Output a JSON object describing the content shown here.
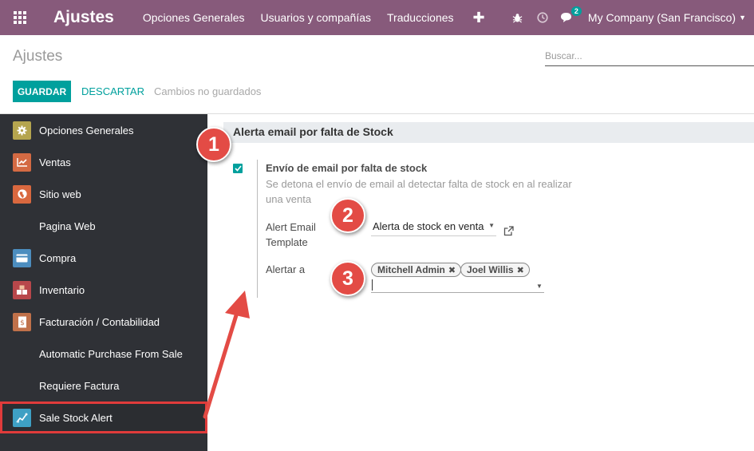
{
  "navbar": {
    "brand": "Ajustes",
    "menu": [
      "Opciones Generales",
      "Usuarios y compañías",
      "Traducciones"
    ],
    "chat_count": "2",
    "company": "My Company (San Francisco)"
  },
  "control_panel": {
    "title": "Ajustes",
    "search_placeholder": "Buscar...",
    "save_label": "GUARDAR",
    "discard_label": "DESCARTAR",
    "unsaved_label": "Cambios no guardados"
  },
  "sidebar": {
    "items": [
      {
        "label": "Opciones Generales",
        "icon": "gear-icon",
        "color": "#b5a54f"
      },
      {
        "label": "Ventas",
        "icon": "sales-chart-icon",
        "color": "#d46a43"
      },
      {
        "label": "Sitio web",
        "icon": "globe-icon",
        "color": "#d9683f"
      },
      {
        "label": "Pagina Web",
        "icon": "",
        "color": ""
      },
      {
        "label": "Compra",
        "icon": "credit-card-icon",
        "color": "#4c8dbf"
      },
      {
        "label": "Inventario",
        "icon": "boxes-icon",
        "color": "#b8474b"
      },
      {
        "label": "Facturación / Contabilidad",
        "icon": "invoice-icon",
        "color": "#c0714a"
      },
      {
        "label": "Automatic Purchase From Sale",
        "icon": "",
        "color": ""
      },
      {
        "label": "Requiere Factura",
        "icon": "",
        "color": ""
      },
      {
        "label": "Sale Stock Alert",
        "icon": "stock-alert-icon",
        "color": "#3ea0c4"
      }
    ]
  },
  "section": {
    "title": "Alerta email por falta de Stock",
    "setting_title": "Envío de email por falta de stock",
    "setting_desc": "Se detona el envío de email al detectar falta de stock en al realizar una venta",
    "checked": true,
    "template_label": "Alert Email Template",
    "template_value": "Alerta de stock en venta",
    "alert_label": "Alertar a",
    "tags": [
      "Mitchell Admin",
      "Joel Willis"
    ]
  },
  "annotations": [
    "1",
    "2",
    "3"
  ],
  "colors": {
    "navbar": "#875a7b",
    "accent": "#00a09d",
    "sidebar_bg": "#2f3136",
    "annotation": "#e34b45"
  }
}
